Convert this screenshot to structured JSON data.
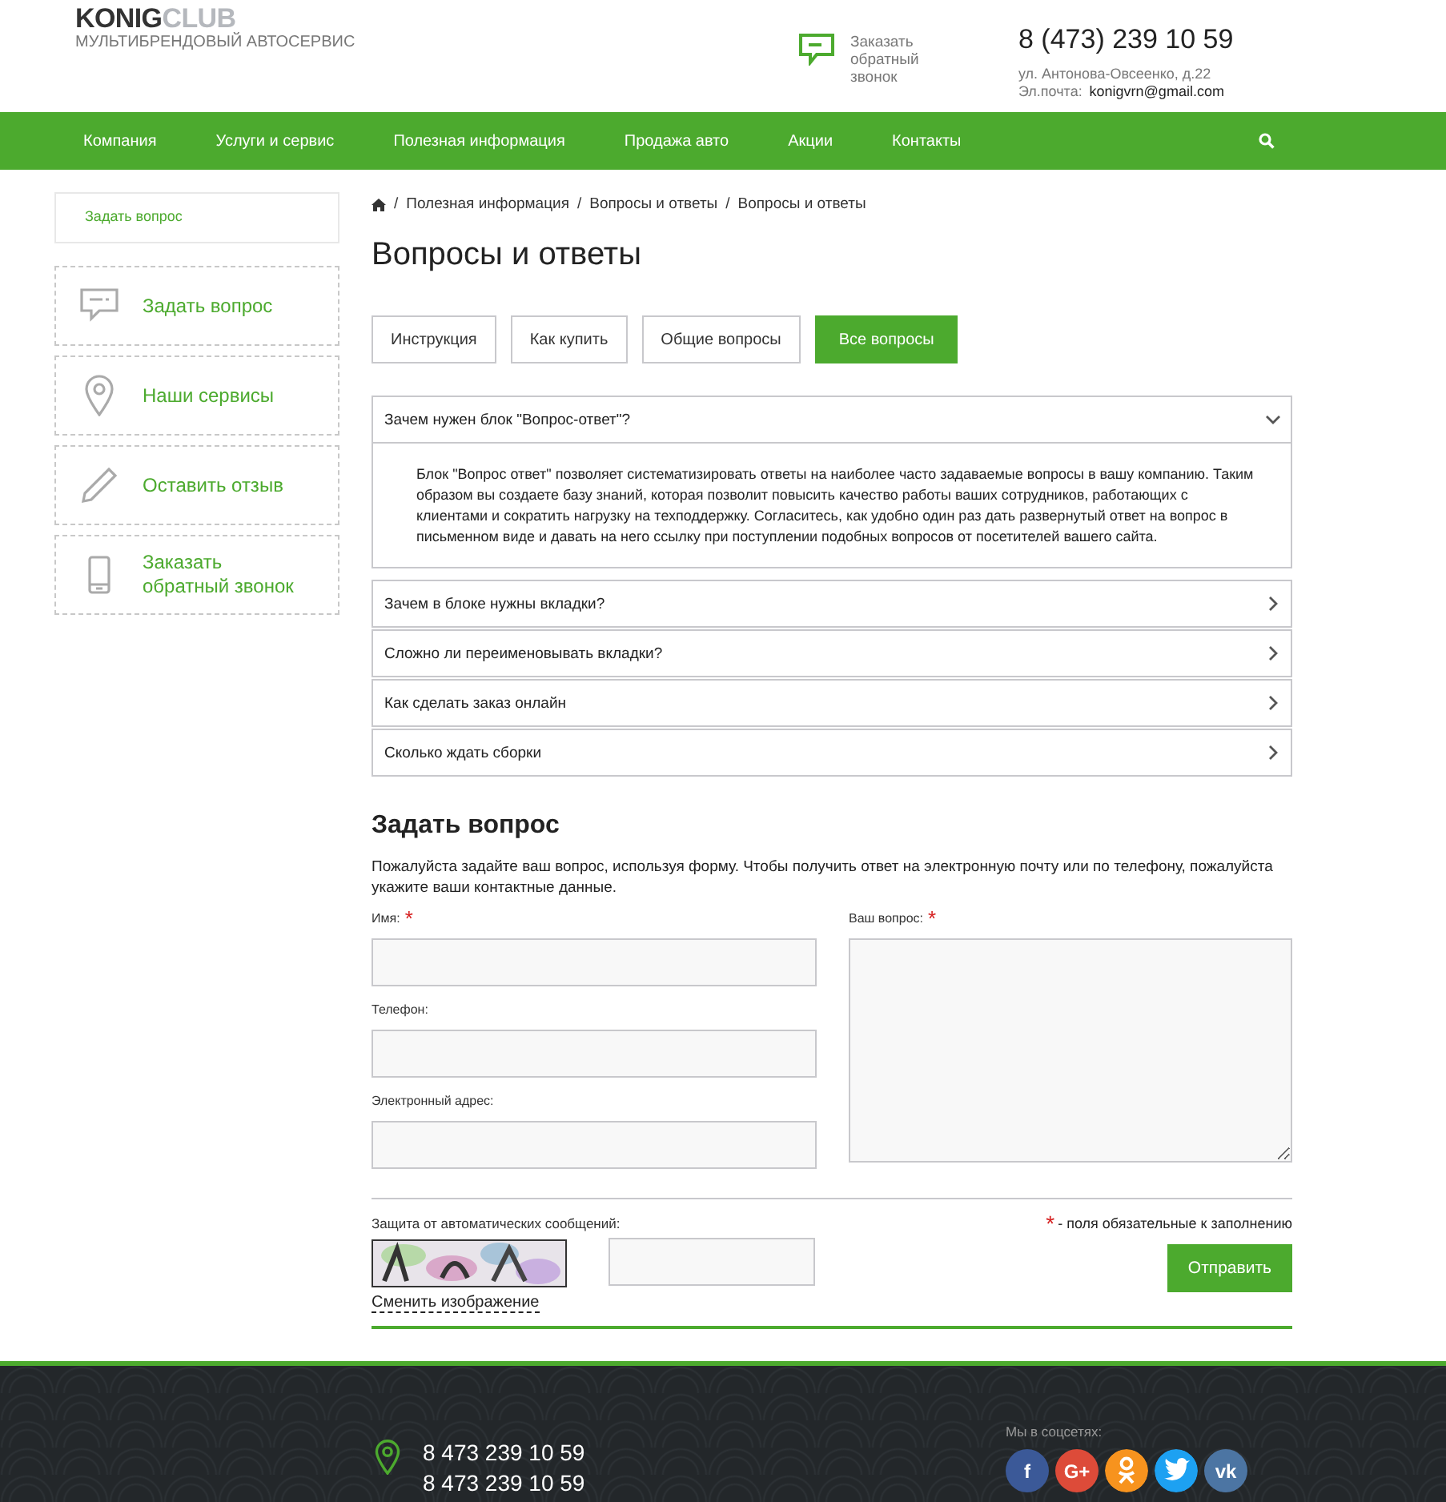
{
  "header": {
    "logo_main": "KONIG",
    "logo_accent": "CLUB",
    "tagline": "МУЛЬТИБРЕНДОВЫЙ АВТОСЕРВИС",
    "callback": "Заказать обратный звонок",
    "phone": "8 (473) 239 10 59",
    "address": "ул. Антонова-Овсеенко, д.22",
    "email_label": "Эл.почта:",
    "email": "konigvrn@gmail.com"
  },
  "nav": {
    "items": [
      "Компания",
      "Услуги и сервис",
      "Полезная информация",
      "Продажа авто",
      "Акции",
      "Контакты"
    ]
  },
  "sidebar": {
    "top_link": "Задать вопрос",
    "items": [
      {
        "kind": "chat",
        "label": "Задать вопрос"
      },
      {
        "kind": "pin",
        "label": "Наши сервисы"
      },
      {
        "kind": "pencil",
        "label": "Оставить отзыв"
      },
      {
        "kind": "phone",
        "label": "Заказать обратный звонок"
      }
    ]
  },
  "breadcrumb_separator": "/",
  "breadcrumbs": [
    "Полезная информация",
    "Вопросы и ответы",
    "Вопросы и ответы"
  ],
  "title": "Вопросы и ответы",
  "tabs": [
    {
      "label": "Инструкция",
      "selected": false
    },
    {
      "label": "Как купить",
      "selected": false
    },
    {
      "label": "Общие вопросы",
      "selected": false
    },
    {
      "label": "Все вопросы",
      "selected": true
    }
  ],
  "faq": [
    {
      "question": "Зачем нужен блок \"Вопрос-ответ\"?",
      "expanded": true,
      "answer": "Блок \"Вопрос ответ\" позволяет систематизировать ответы на наиболее часто задаваемые вопросы в вашу компанию. Таким образом вы создаете базу знаний, которая позволит повысить качество работы ваших сотрудников, работающих с клиентами и сократить нагрузку на техподдержку. Согласитесь, как удобно один раз дать развернутый ответ на вопрос в письменном виде и давать на него ссылку при поступлении подобных вопросов от посетителей вашего сайта."
    },
    {
      "question": "Зачем в блоке нужны вкладки?",
      "expanded": false
    },
    {
      "question": "Сложно ли переименовывать вкладки?",
      "expanded": false
    },
    {
      "question": "Как сделать заказ онлайн",
      "expanded": false
    },
    {
      "question": "Сколько ждать сборки",
      "expanded": false
    }
  ],
  "form": {
    "title": "Задать вопрос",
    "intro": "Пожалуйста задайте ваш вопрос, используя форму. Чтобы получить ответ на электронную почту или по телефону, пожалуйста укажите ваши контактные данные.",
    "fields": [
      {
        "label": "Имя:",
        "required": true
      },
      {
        "label": "Телефон:",
        "required": false
      },
      {
        "label": "Электронный адрес:",
        "required": false
      }
    ],
    "question": {
      "label": "Ваш вопрос:",
      "required": true
    },
    "captcha_label": "Защита от автоматических сообщений:",
    "captcha_refresh": "Сменить изображение",
    "required_mark": "*",
    "required_note": "- поля обязательные к заполнению",
    "submit": "Отправить"
  },
  "footer": {
    "phones": [
      "8 473 239 10 59",
      "8 473 239 10 59"
    ],
    "social_label": "Мы в соцсетях:",
    "social": [
      {
        "kind": "facebook",
        "glyph": "f",
        "color": "#3b5998"
      },
      {
        "kind": "google",
        "glyph": "G+",
        "color": "#dd4b39"
      },
      {
        "kind": "odnoklassniki",
        "color": "#f7931e"
      },
      {
        "kind": "twitter",
        "color": "#1da1f2"
      },
      {
        "kind": "vk",
        "glyph": "vk",
        "color": "#4c75a3"
      }
    ]
  }
}
